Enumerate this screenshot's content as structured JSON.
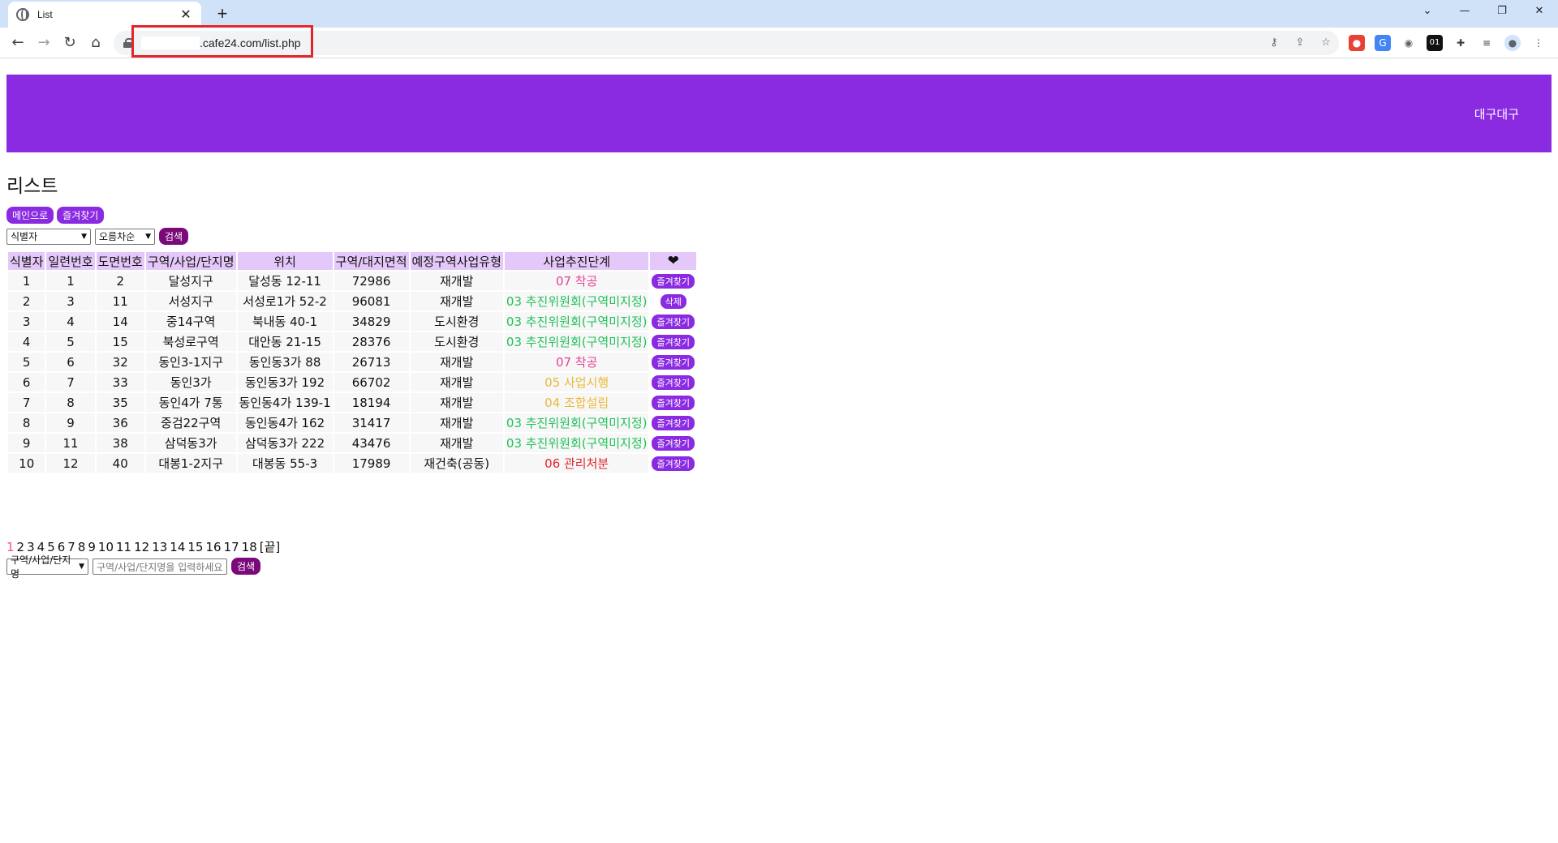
{
  "browser": {
    "tab_title": "List",
    "new_tab_label": "+",
    "url": ".cafe24.com/list.php"
  },
  "header": {
    "user_label": "대구대구"
  },
  "page": {
    "title": "리스트",
    "main_button": "메인으로",
    "favorites_button": "즐겨찾기"
  },
  "sort": {
    "field_select": "식별자",
    "order_select": "오름차순",
    "search_button": "검색"
  },
  "table": {
    "headers": [
      "식별자",
      "일련번호",
      "도면번호",
      "구역/사업/단지명",
      "위치",
      "구역/대지면적",
      "예정구역사업유형",
      "사업추진단계"
    ],
    "heart_icon": "heart-icon",
    "rows": [
      {
        "id": "1",
        "serial": "1",
        "drawing": "2",
        "name": "달성지구",
        "location": "달성동 12-11",
        "area": "72986",
        "type": "재개발",
        "stage": "07 착공",
        "stage_color": "pink",
        "action": "즐겨찾기"
      },
      {
        "id": "2",
        "serial": "3",
        "drawing": "11",
        "name": "서성지구",
        "location": "서성로1가 52-2",
        "area": "96081",
        "type": "재개발",
        "stage": "03 추진위원회(구역미지정)",
        "stage_color": "green",
        "action": "삭제"
      },
      {
        "id": "3",
        "serial": "4",
        "drawing": "14",
        "name": "중14구역",
        "location": "북내동 40-1",
        "area": "34829",
        "type": "도시환경",
        "stage": "03 추진위원회(구역미지정)",
        "stage_color": "green",
        "action": "즐겨찾기"
      },
      {
        "id": "4",
        "serial": "5",
        "drawing": "15",
        "name": "북성로구역",
        "location": "대안동 21-15",
        "area": "28376",
        "type": "도시환경",
        "stage": "03 추진위원회(구역미지정)",
        "stage_color": "green",
        "action": "즐겨찾기"
      },
      {
        "id": "5",
        "serial": "6",
        "drawing": "32",
        "name": "동인3-1지구",
        "location": "동인동3가 88",
        "area": "26713",
        "type": "재개발",
        "stage": "07 착공",
        "stage_color": "pink",
        "action": "즐겨찾기"
      },
      {
        "id": "6",
        "serial": "7",
        "drawing": "33",
        "name": "동인3가",
        "location": "동인동3가 192",
        "area": "66702",
        "type": "재개발",
        "stage": "05 사업시행",
        "stage_color": "yellow",
        "action": "즐겨찾기"
      },
      {
        "id": "7",
        "serial": "8",
        "drawing": "35",
        "name": "동인4가 7통",
        "location": "동인동4가 139-1",
        "area": "18194",
        "type": "재개발",
        "stage": "04 조합설립",
        "stage_color": "yellow",
        "action": "즐겨찾기"
      },
      {
        "id": "8",
        "serial": "9",
        "drawing": "36",
        "name": "중검22구역",
        "location": "동인동4가 162",
        "area": "31417",
        "type": "재개발",
        "stage": "03 추진위원회(구역미지정)",
        "stage_color": "green",
        "action": "즐겨찾기"
      },
      {
        "id": "9",
        "serial": "11",
        "drawing": "38",
        "name": "삼덕동3가",
        "location": "삼덕동3가 222",
        "area": "43476",
        "type": "재개발",
        "stage": "03 추진위원회(구역미지정)",
        "stage_color": "green",
        "action": "즐겨찾기"
      },
      {
        "id": "10",
        "serial": "12",
        "drawing": "40",
        "name": "대봉1-2지구",
        "location": "대봉동 55-3",
        "area": "17989",
        "type": "재건축(공동)",
        "stage": "06 관리처분",
        "stage_color": "red",
        "action": "즐겨찾기"
      }
    ]
  },
  "pagination": {
    "pages": [
      "1",
      "2",
      "3",
      "4",
      "5",
      "6",
      "7",
      "8",
      "9",
      "10",
      "11",
      "12",
      "13",
      "14",
      "15",
      "16",
      "17",
      "18"
    ],
    "current": "1",
    "end_label": "[끝]"
  },
  "search": {
    "field_select": "구역/사업/단지명",
    "placeholder": "구역/사업/단지명을 입력하세요",
    "button": "검색"
  },
  "colors": {
    "header_bg": "#8a2be2",
    "th_bg": "#e5c8fa",
    "pill_bg": "#8a2be2",
    "search_btn_bg": "#7a0a7a",
    "stage_green": "#21c15a",
    "stage_pink": "#e8409a",
    "stage_yellow": "#e8b93a",
    "stage_red": "#e1262b"
  }
}
